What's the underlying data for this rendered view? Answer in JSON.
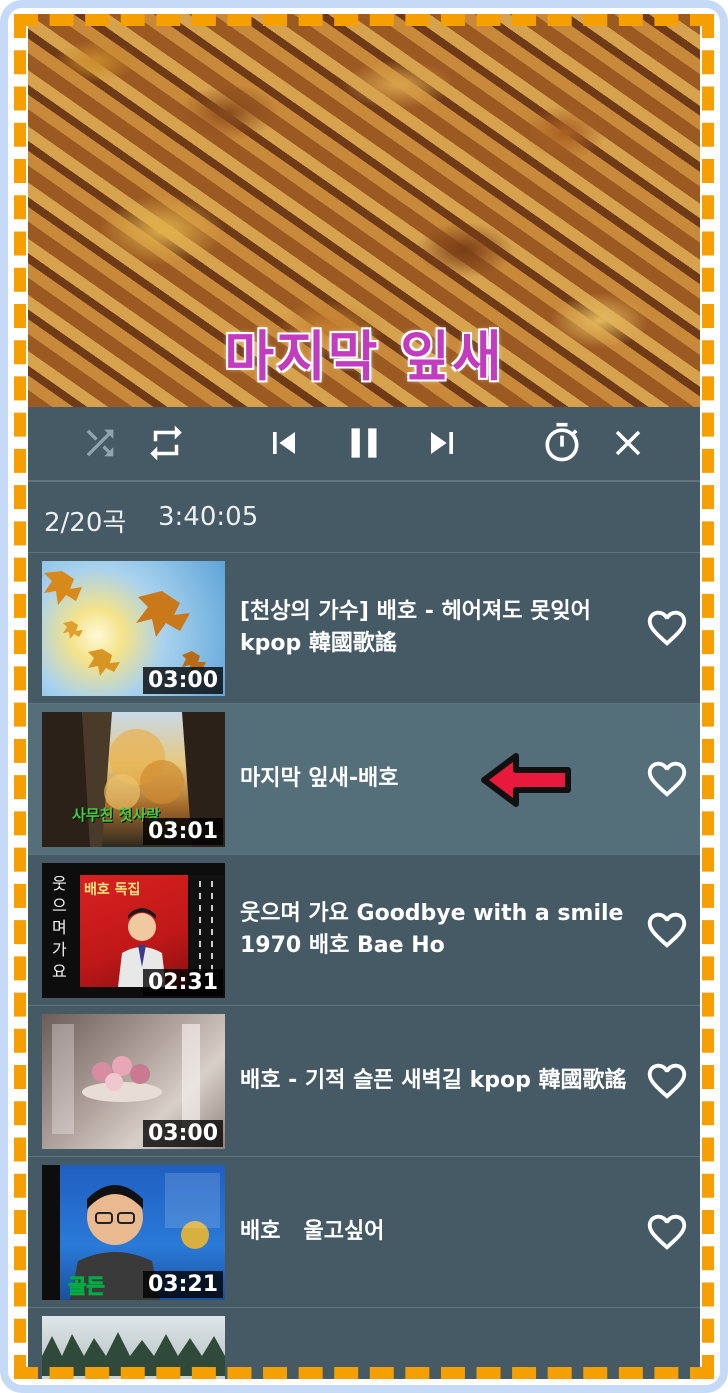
{
  "video": {
    "caption": "마지막 잎새"
  },
  "controls": [
    {
      "name": "shuffle-icon"
    },
    {
      "name": "repeat-icon"
    },
    {
      "name": "skip-previous-icon"
    },
    {
      "name": "pause-icon"
    },
    {
      "name": "skip-next-icon"
    },
    {
      "name": "timer-icon"
    },
    {
      "name": "close-icon"
    }
  ],
  "playlist_info": {
    "position": "2/20곡",
    "total_duration": "3:40:05"
  },
  "playlist": [
    {
      "title": "[천상의 가수] 배호 - 헤어져도 못잊어 kpop 韓國歌謠",
      "duration": "03:00"
    },
    {
      "title": "마지막 잎새-배호",
      "duration": "03:01",
      "thumb_text": "사무친 첫사랑"
    },
    {
      "title": "웃으며 가요 Goodbye with a smile 1970 배호 Bae Ho",
      "duration": "02:31",
      "thumb_vertical": "웃으며가요",
      "thumb_album": "배호 독집"
    },
    {
      "title": "배호 - 기적 슬픈 새벽길 kpop 韓國歌謠",
      "duration": "03:00"
    },
    {
      "title": "배호   울고싶어",
      "duration": "03:21"
    },
    {
      "title": "",
      "duration": ""
    }
  ],
  "colors": {
    "panel": "#455a64",
    "active_row": "#546e7a",
    "highlight_frame": "#f59f00",
    "arrow": "#e8193c"
  }
}
